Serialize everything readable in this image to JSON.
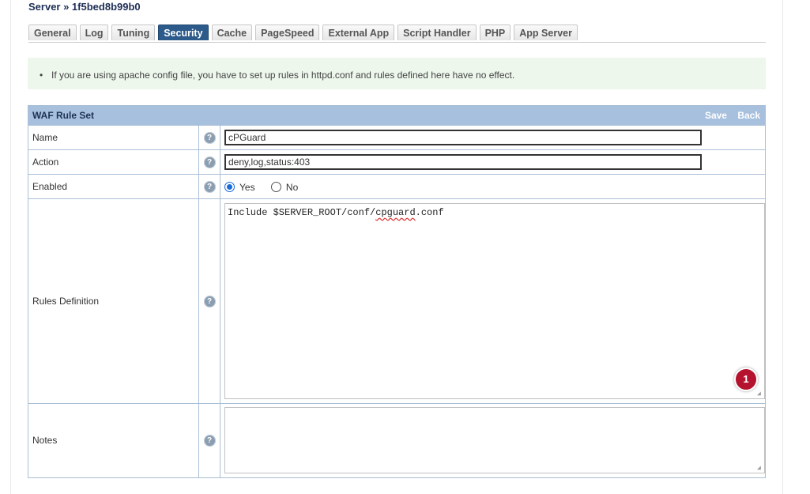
{
  "page": {
    "title": "Server » 1f5bed8b99b0"
  },
  "tabs": [
    {
      "label": "General"
    },
    {
      "label": "Log"
    },
    {
      "label": "Tuning"
    },
    {
      "label": "Security",
      "active": true
    },
    {
      "label": "Cache"
    },
    {
      "label": "PageSpeed"
    },
    {
      "label": "External App"
    },
    {
      "label": "Script Handler"
    },
    {
      "label": "PHP"
    },
    {
      "label": "App Server"
    }
  ],
  "notice": {
    "text": "If you are using apache config file, you have to set up rules in httpd.conf and rules defined here have no effect."
  },
  "panel": {
    "title": "WAF Rule Set",
    "save_label": "Save",
    "back_label": "Back",
    "help_glyph": "?",
    "fields": {
      "name": {
        "label": "Name",
        "value": "cPGuard"
      },
      "action": {
        "label": "Action",
        "value": "deny,log,status:403"
      },
      "enabled": {
        "label": "Enabled",
        "yes_label": "Yes",
        "no_label": "No",
        "selected": "Yes"
      },
      "rules": {
        "label": "Rules Definition",
        "value_prefix": "Include $SERVER_ROOT/conf/",
        "value_misspelled": "cpguard",
        "value_suffix": ".conf",
        "badge_count": "1"
      },
      "notes": {
        "label": "Notes",
        "value": ""
      }
    }
  },
  "colors": {
    "accent": "#2c5a8a",
    "panel_header": "#a7c0dd",
    "notice_bg": "#edf7ec",
    "badge": "#b4122e"
  },
  "icons": {
    "help": "help-circle-icon",
    "grip": "resize-grip-icon"
  }
}
